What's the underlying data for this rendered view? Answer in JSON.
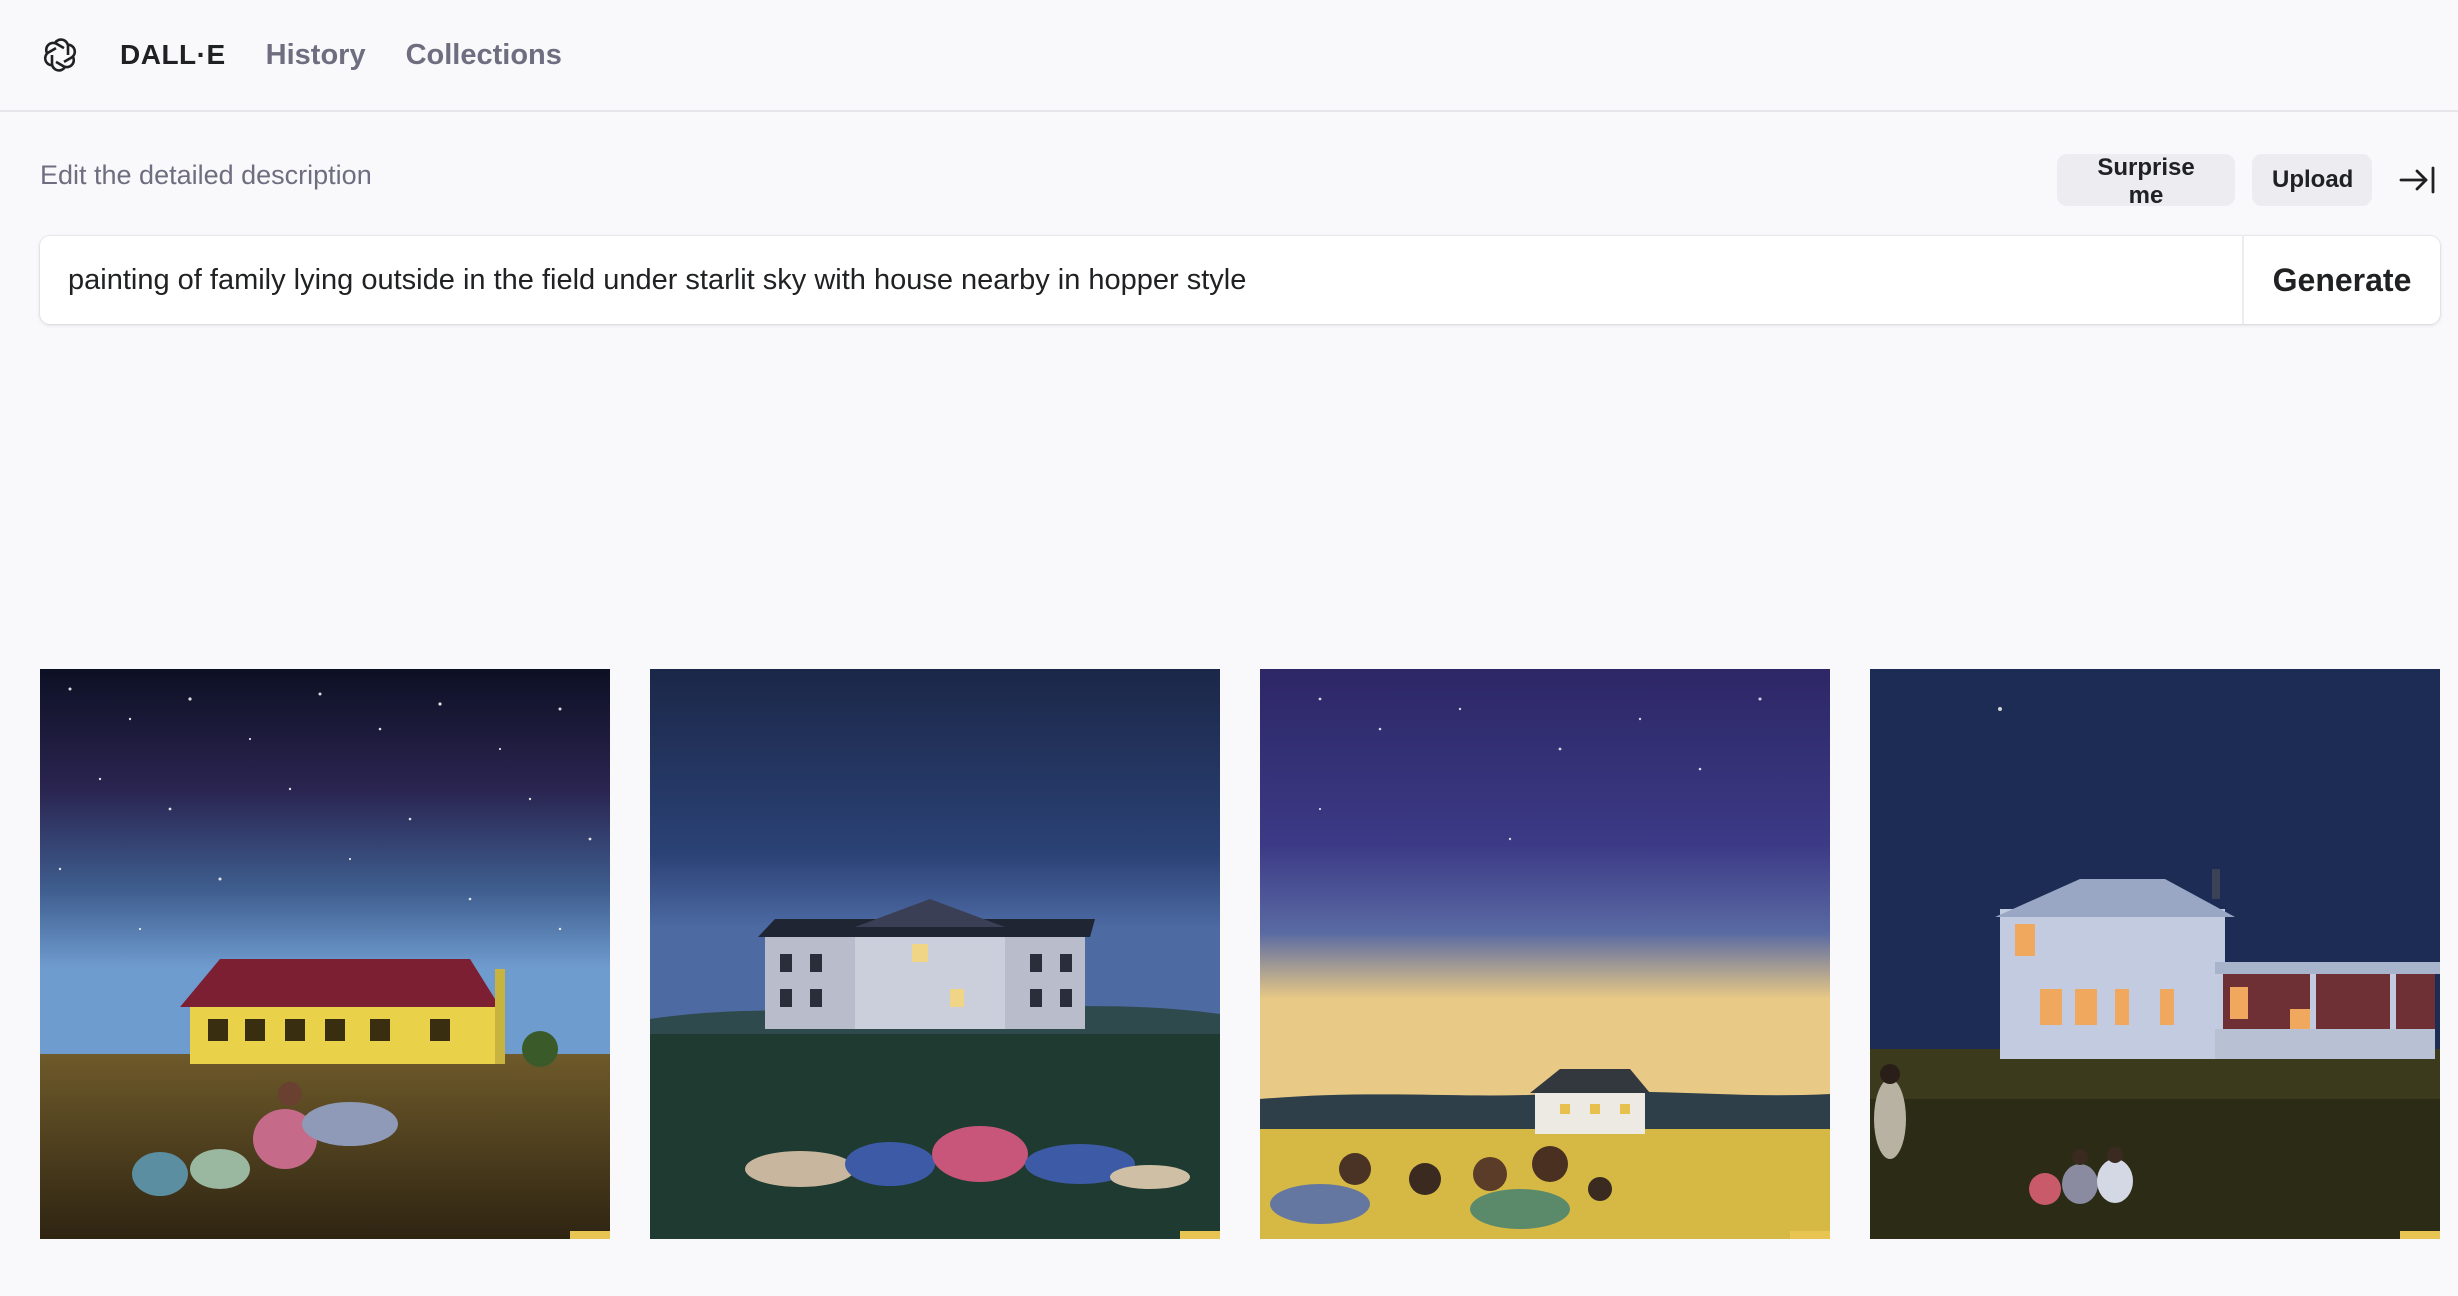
{
  "header": {
    "brand": "DALL·E",
    "nav": [
      {
        "label": "History"
      },
      {
        "label": "Collections"
      }
    ]
  },
  "editor": {
    "label": "Edit the detailed description",
    "surprise_label": "Surprise me",
    "upload_label": "Upload",
    "prompt_value": "painting of family lying outside in the field under starlit sky with house nearby in hopper style",
    "generate_label": "Generate"
  },
  "results": [
    {
      "theme": "yellow-house-starry-sky"
    },
    {
      "theme": "white-colonial-house-blue-sky"
    },
    {
      "theme": "farmhouse-purple-sky-golden-field"
    },
    {
      "theme": "lit-farmhouse-night-navy-sky"
    }
  ],
  "colors": {
    "accent_text": "#202123",
    "muted_text": "#6e6e80",
    "button_bg": "#ececf1",
    "page_bg": "#f9f9fb"
  }
}
